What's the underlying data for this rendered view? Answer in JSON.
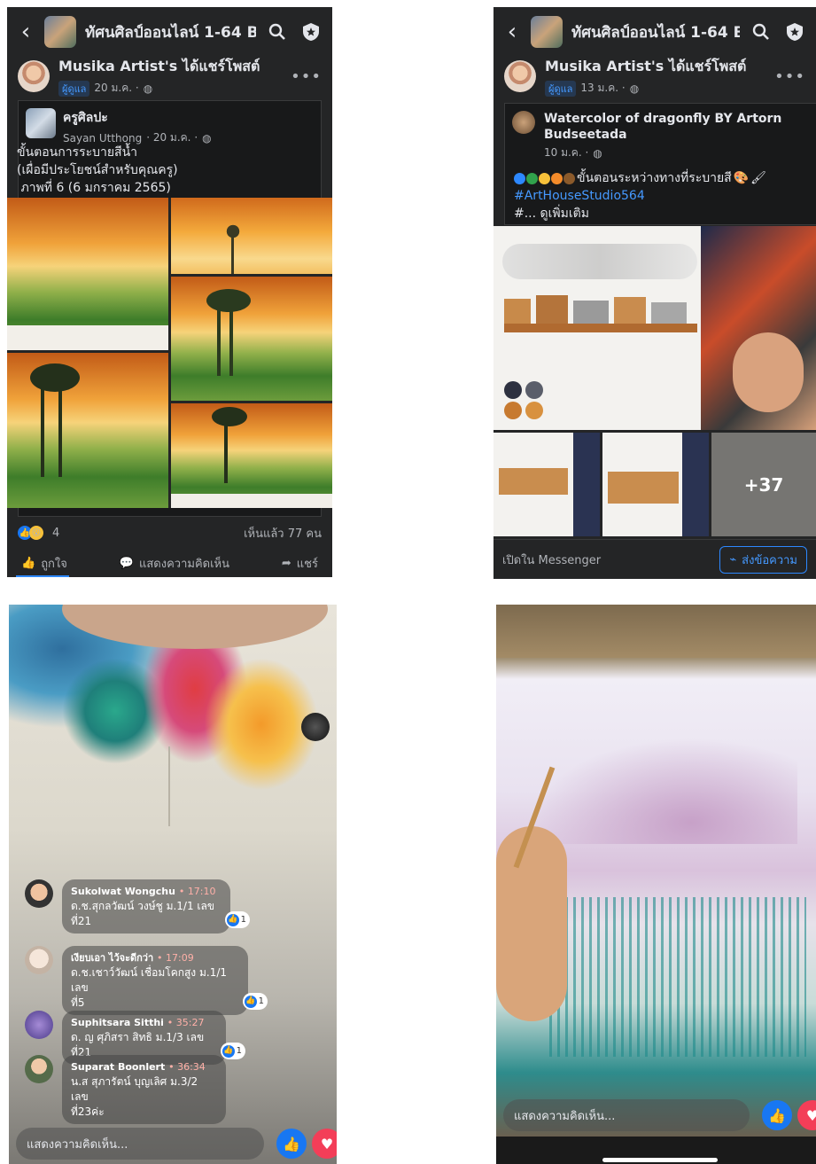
{
  "panel1": {
    "group_title": "ทัศนศิลป์ออนไลน์ 1-64 B...",
    "poster_name": "Musika Artist's ได้แชร์โพสต์",
    "poster_role": "ผู้ดูแล",
    "poster_date": "20 ม.ค. ·",
    "shared_name": "ครูศิลปะ",
    "shared_author": "Sayan Utthong",
    "shared_date": "· 20 ม.ค. ·",
    "line1": "ขั้นตอนการระบายสีน้ำ",
    "line2": "(เผื่อมีประโยชน์สำหรับคุณครู)",
    "line3": " ภาพที่ 6 (6 มกราคม 2565)",
    "reaction_count": "4",
    "views": "เห็นแล้ว 77 คน",
    "like_label": "ถูกใจ",
    "comment_label": "แสดงความคิดเห็น",
    "share_label": "แชร์"
  },
  "panel2": {
    "group_title": "ทัศนศิลป์ออนไลน์ 1-64 B...",
    "poster_name": "Musika Artist's ได้แชร์โพสต์",
    "poster_role": "ผู้ดูแล",
    "poster_date": "13 ม.ค. ·",
    "shared_title": "Watercolor of dragonfly BY Artorn Budseetada",
    "shared_date": "10 ม.ค. ·",
    "caption": "ขั้นตอนระหว่างทางที่ระบายสี",
    "hashtag": "#ArtHouseStudio564",
    "see_more": "#... ดูเพิ่มเติม",
    "more_count": "+37",
    "messenger_label": "เปิดใน Messenger",
    "send_button": "ส่งข้อความ"
  },
  "panel3": {
    "comments": [
      {
        "name": "Sukolwat Wongchu",
        "time": "17:10",
        "text1": "ด.ช.สุกลวัฒน์  วงษ์ชู  ม.1/1 เลข",
        "text2": "ที่21",
        "likes": "1"
      },
      {
        "name": "เงียบเอา ไว้จะดีกว่า",
        "time": "17:09",
        "text1": "ด.ช.เชาว์วัฒน์ เชื่อมโคกสูง ม.1/1 เลข",
        "text2": "ที่5",
        "likes": "1"
      },
      {
        "name": "Suphitsara Sitthi",
        "time": "35:27",
        "text1": "ด. ญ ศุภิสรา สิทธิ ม.1/3 เลขที่21",
        "text2": "",
        "likes": "1"
      },
      {
        "name": "Suparat Boonlert",
        "time": "36:34",
        "text1": "น.ส สุภารัตน์ บุญเลิศ ม.3/2 เลข",
        "text2": "ที่23ค่ะ",
        "likes": ""
      }
    ],
    "comment_placeholder": "แสดงความคิดเห็น..."
  },
  "panel4": {
    "comment_placeholder": "แสดงความคิดเห็น..."
  },
  "colors": {
    "fb_dark": "#242526",
    "fb_blue": "#1877f2",
    "link_blue": "#4599ff",
    "heart_red": "#f33e58"
  }
}
